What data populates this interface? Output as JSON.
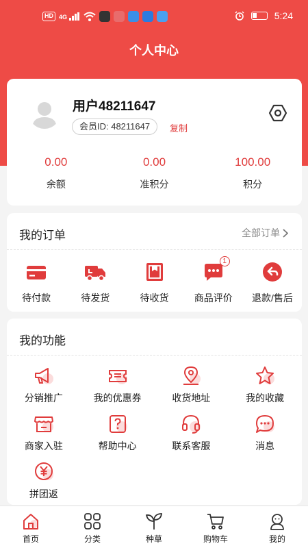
{
  "status_bar": {
    "network_tags": [
      "HD",
      "4G"
    ],
    "time": "5:24"
  },
  "page": {
    "title": "个人中心"
  },
  "profile": {
    "username": "用户48211647",
    "member_id": "会员ID: 48211647",
    "copy_label": "复制",
    "stats": [
      {
        "value": "0.00",
        "label": "余额"
      },
      {
        "value": "0.00",
        "label": "准积分"
      },
      {
        "value": "100.00",
        "label": "积分"
      }
    ]
  },
  "orders": {
    "title": "我的订单",
    "all_label": "全部订单",
    "items": [
      {
        "label": "待付款",
        "icon": "wallet-icon",
        "badge": ""
      },
      {
        "label": "待发货",
        "icon": "truck-icon",
        "badge": ""
      },
      {
        "label": "待收货",
        "icon": "package-icon",
        "badge": ""
      },
      {
        "label": "商品评价",
        "icon": "comment-icon",
        "badge": "1"
      },
      {
        "label": "退款/售后",
        "icon": "return-icon",
        "badge": ""
      }
    ]
  },
  "functions": {
    "title": "我的功能",
    "items": [
      {
        "label": "分销推广",
        "icon": "megaphone-icon"
      },
      {
        "label": "我的优惠券",
        "icon": "coupon-icon"
      },
      {
        "label": "收货地址",
        "icon": "location-icon"
      },
      {
        "label": "我的收藏",
        "icon": "star-icon"
      },
      {
        "label": "商家入驻",
        "icon": "store-icon"
      },
      {
        "label": "帮助中心",
        "icon": "help-icon"
      },
      {
        "label": "联系客服",
        "icon": "headset-icon"
      },
      {
        "label": "消息",
        "icon": "message-icon"
      },
      {
        "label": "拼团返",
        "icon": "yuan-icon"
      }
    ]
  },
  "tabbar": {
    "items": [
      {
        "label": "首页",
        "icon": "home-icon"
      },
      {
        "label": "分类",
        "icon": "category-icon"
      },
      {
        "label": "种草",
        "icon": "sprout-icon"
      },
      {
        "label": "购物车",
        "icon": "cart-icon"
      },
      {
        "label": "我的",
        "icon": "profile-icon"
      }
    ]
  },
  "colors": {
    "accent": "#e03c3c",
    "header": "#ee4b46",
    "background": "#f4f4f4"
  }
}
